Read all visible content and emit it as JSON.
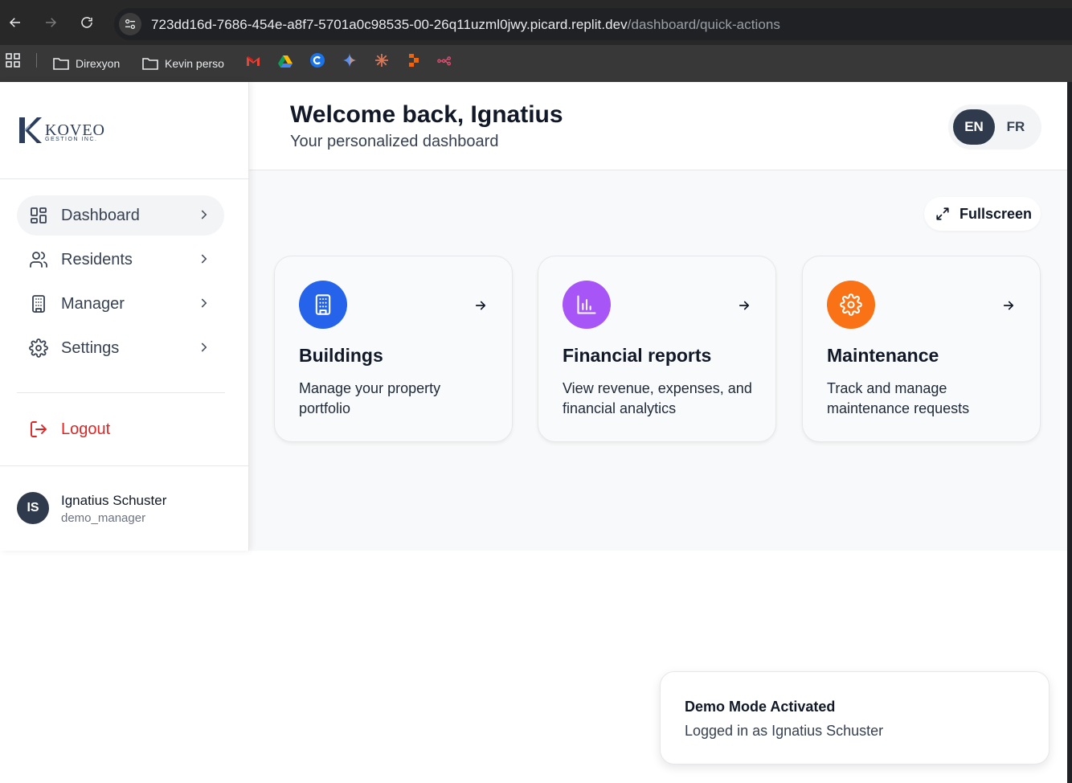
{
  "browser": {
    "url_host": "723dd16d-7686-454e-a8f7-5701a0c98535-00-26q11uzml0jwy.picard.replit.dev",
    "url_path": "/dashboard/quick-actions",
    "bookmarks": [
      {
        "label": "Direxyon",
        "icon": "folder-icon"
      },
      {
        "label": "Kevin perso",
        "icon": "folder-icon"
      }
    ]
  },
  "brand": {
    "logo_text": "KOVEO",
    "logo_sub": "GESTION INC."
  },
  "sidebar": {
    "items": [
      {
        "label": "Dashboard",
        "icon": "dashboard-icon"
      },
      {
        "label": "Residents",
        "icon": "users-icon"
      },
      {
        "label": "Manager",
        "icon": "building-icon"
      },
      {
        "label": "Settings",
        "icon": "gear-icon"
      }
    ],
    "logout_label": "Logout",
    "user": {
      "initials": "IS",
      "name": "Ignatius Schuster",
      "username": "demo_manager"
    }
  },
  "header": {
    "title": "Welcome back, Ignatius",
    "subtitle": "Your personalized dashboard",
    "languages": [
      "EN",
      "FR"
    ],
    "active_language": "EN"
  },
  "toolbar": {
    "fullscreen_label": "Fullscreen"
  },
  "cards": [
    {
      "title": "Buildings",
      "description": "Manage your property portfolio",
      "icon": "building-icon",
      "color": "#2563eb"
    },
    {
      "title": "Financial reports",
      "description": "View revenue, expenses, and financial analytics",
      "icon": "bar-chart-icon",
      "color": "#a855f7"
    },
    {
      "title": "Maintenance",
      "description": "Track and manage maintenance requests",
      "icon": "gear-icon",
      "color": "#f97316"
    }
  ],
  "toast": {
    "title": "Demo Mode Activated",
    "message": "Logged in as Ignatius Schuster"
  },
  "colors": {
    "primary_dark": "#2f3b4c",
    "danger": "#dc2626"
  }
}
